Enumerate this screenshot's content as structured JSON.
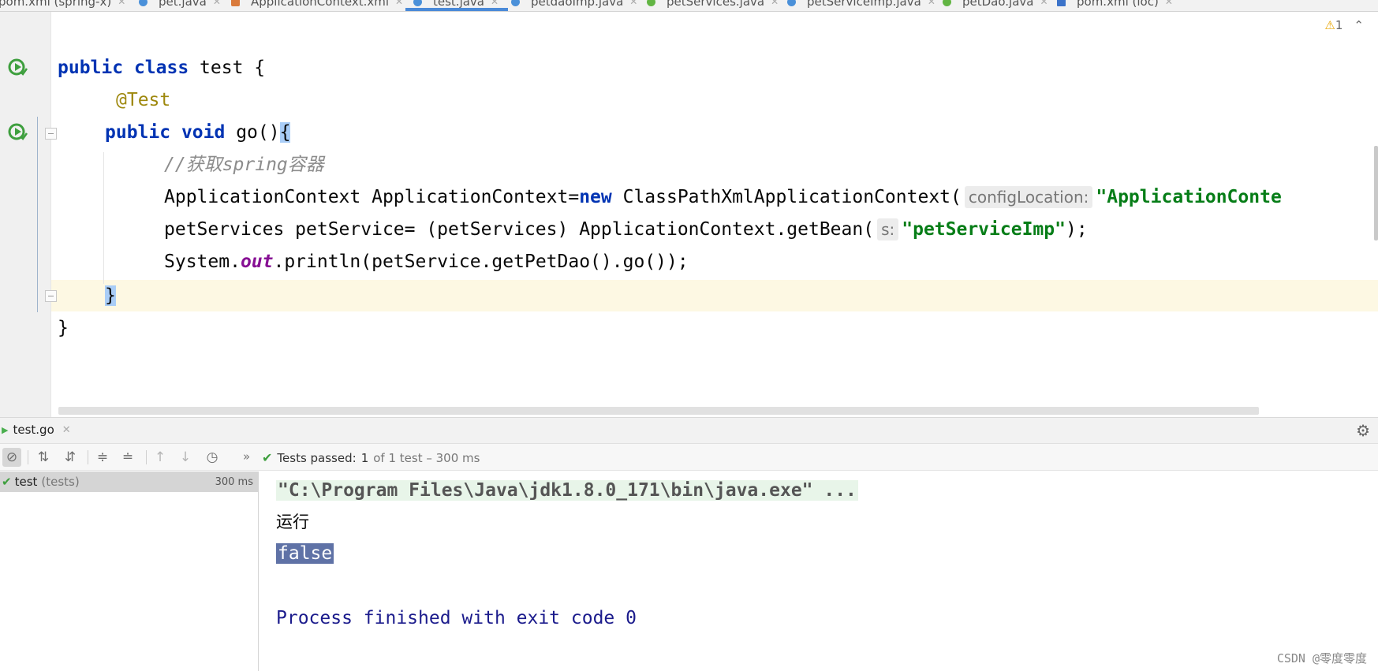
{
  "editor_tabs": [
    {
      "label": "pom.xml (spring-x)",
      "icon": "maven-icon"
    },
    {
      "label": "pet.java",
      "icon": "class-icon"
    },
    {
      "label": "ApplicationContext.xml",
      "icon": "xml-icon"
    },
    {
      "label": "test.java",
      "icon": "class-icon",
      "active": true
    },
    {
      "label": "petdaoImp.java",
      "icon": "class-icon"
    },
    {
      "label": "petServices.java",
      "icon": "interface-icon"
    },
    {
      "label": "petServiceImp.java",
      "icon": "class-icon"
    },
    {
      "label": "petDao.java",
      "icon": "interface-icon"
    },
    {
      "label": "pom.xml (ioc)",
      "icon": "maven-icon"
    }
  ],
  "tab_close_glyph": "✕",
  "warnings": {
    "count": "1"
  },
  "code": {
    "line1": {
      "kw1": "public",
      "kw2": "class",
      "rest": " test {"
    },
    "line2": {
      "annotation": "@Test"
    },
    "line3": {
      "kw1": "public",
      "kw2": "void",
      "rest": " go()",
      "brace": "{"
    },
    "line4": {
      "comment": "//获取spring容器"
    },
    "line5": {
      "pre": "ApplicationContext ApplicationContext=",
      "kw": "new",
      "mid": " ClassPathXmlApplicationContext(",
      "hint": "configLocation:",
      "str": "\"ApplicationConte"
    },
    "line6": {
      "pre": "petServices petService= (petServices) ApplicationContext.getBean(",
      "hint": "s:",
      "str": "\"petServiceImp\"",
      "post": ");"
    },
    "line7": {
      "pre": "System.",
      "static": "out",
      "post": ".println(petService.getPetDao().go());"
    },
    "line8": {
      "brace": "}"
    },
    "line9": {
      "brace": "}"
    }
  },
  "run_panel": {
    "tab_label": "test.go",
    "status_label": "Tests passed:",
    "status_count": "1",
    "status_detail": "of 1 test – 300 ms"
  },
  "test_tree": {
    "name": "test",
    "sub": "(tests)",
    "time": "300 ms"
  },
  "console": {
    "cmd": "\"C:\\Program Files\\Java\\jdk1.8.0_171\\bin\\java.exe\" ...",
    "out1": "运行",
    "out2": "false",
    "exit": "Process finished with exit code 0"
  },
  "watermark": "CSDN @零度零度",
  "colors": {
    "keyword": "#0033b3",
    "string": "#067d17",
    "annotation": "#9e880d",
    "comment": "#8c8c8c",
    "pass": "#3e9f3e",
    "selection": "#5f72a6"
  }
}
